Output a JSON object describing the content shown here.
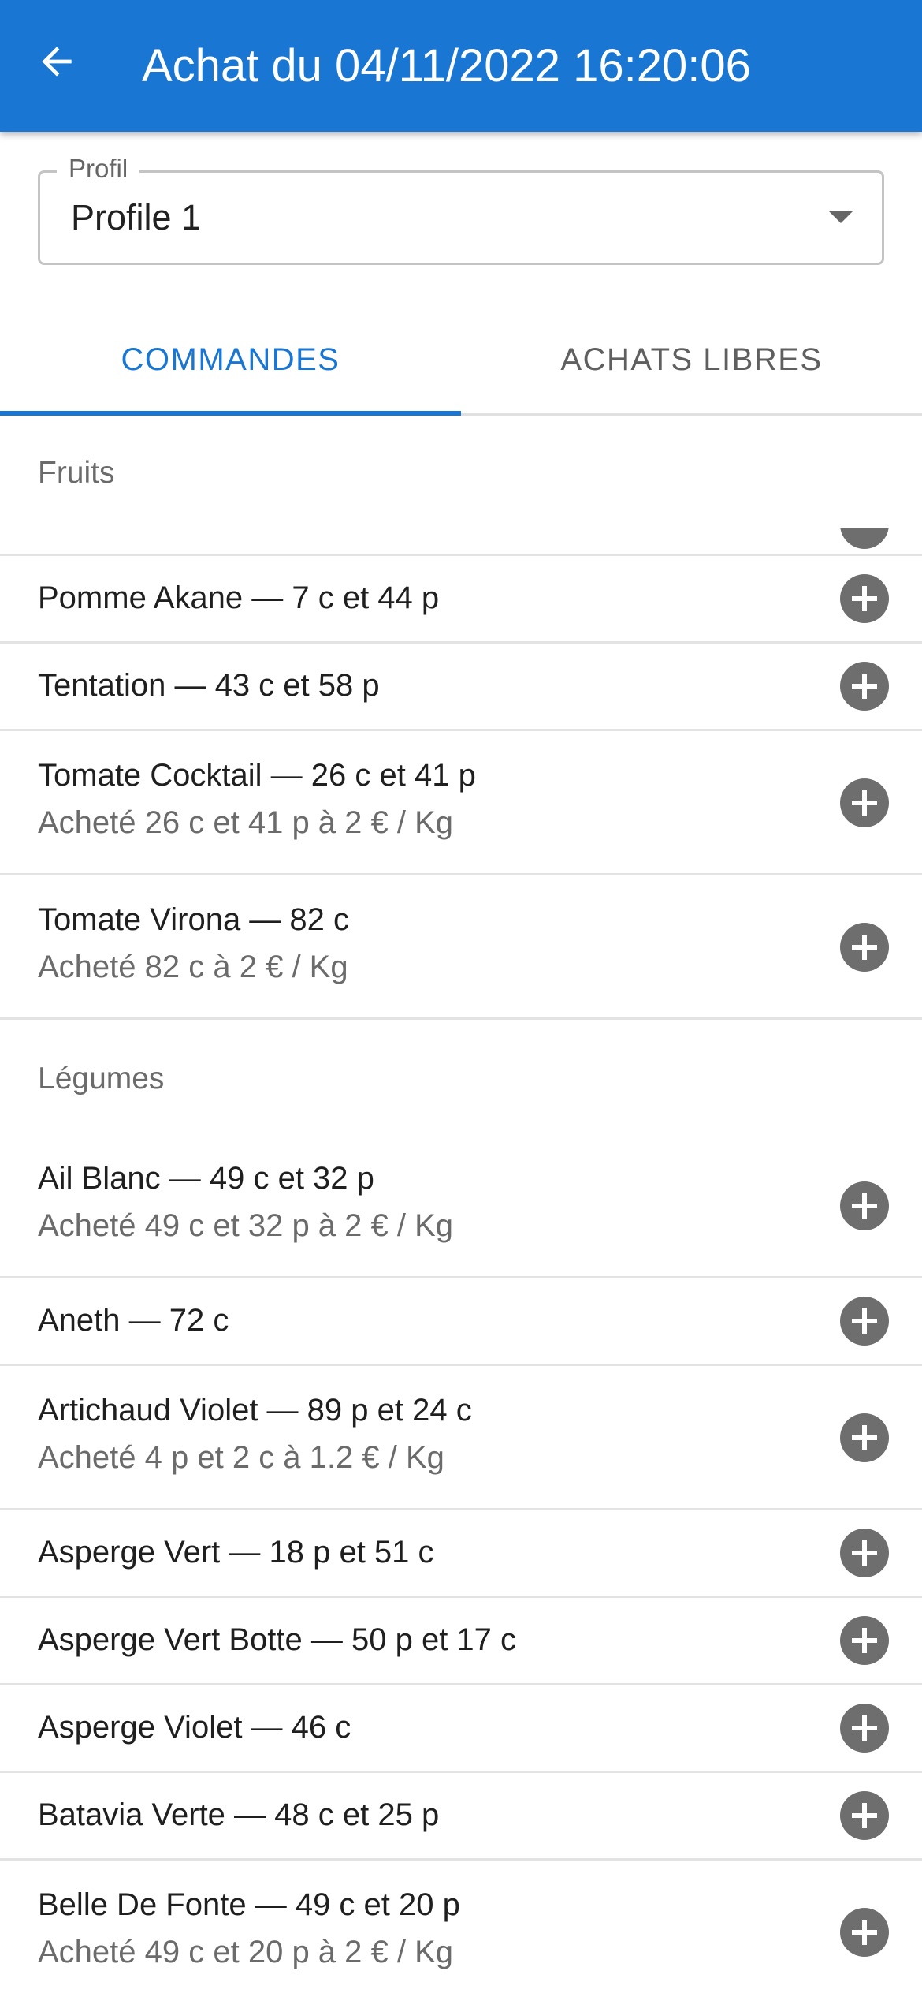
{
  "appbar": {
    "title": "Achat du 04/11/2022 16:20:06",
    "back_icon": "arrow-back-icon"
  },
  "profile": {
    "label": "Profil",
    "value": "Profile 1"
  },
  "tabs": [
    {
      "label": "COMMANDES",
      "active": true
    },
    {
      "label": "ACHATS LIBRES",
      "active": false
    }
  ],
  "sections": [
    {
      "title": "Fruits",
      "items": [
        {
          "name": "Pomme Akane — 7 c et 44 p",
          "detail": ""
        },
        {
          "name": "Tentation — 43 c et 58 p",
          "detail": ""
        },
        {
          "name": "Tomate Cocktail — 26 c et 41 p",
          "detail": "Acheté 26 c et 41 p à 2 € / Kg"
        },
        {
          "name": "Tomate Virona — 82 c",
          "detail": "Acheté 82 c à 2 € / Kg"
        }
      ]
    },
    {
      "title": "Légumes",
      "items": [
        {
          "name": "Ail Blanc — 49 c et 32 p",
          "detail": "Acheté 49 c et 32 p à 2 € / Kg"
        },
        {
          "name": "Aneth — 72 c",
          "detail": ""
        },
        {
          "name": "Artichaud Violet — 89 p et 24 c",
          "detail": "Acheté 4 p et 2 c à 1.2 € / Kg"
        },
        {
          "name": "Asperge Vert — 18 p et 51 c",
          "detail": ""
        },
        {
          "name": "Asperge Vert Botte — 50 p et 17 c",
          "detail": ""
        },
        {
          "name": "Asperge Violet — 46 c",
          "detail": ""
        },
        {
          "name": "Batavia Verte — 48 c et 25 p",
          "detail": ""
        },
        {
          "name": "Belle De Fonte — 49 c et 20 p",
          "detail": "Acheté 49 c et 20 p à 2 € / Kg"
        }
      ]
    }
  ],
  "colors": {
    "primary": "#1976d2",
    "icon_button": "#6e6e6e",
    "secondary_text": "#6b6b6b",
    "divider": "#e3e3e3"
  },
  "icons": {
    "add": "add-circle-icon",
    "dropdown": "caret-down-icon"
  }
}
